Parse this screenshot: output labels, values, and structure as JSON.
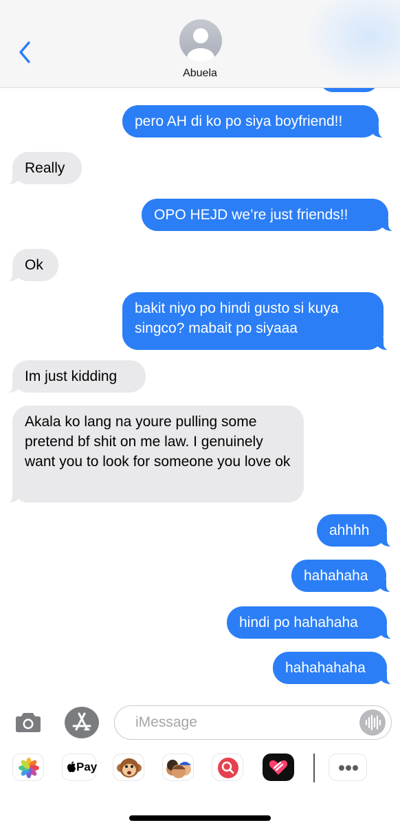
{
  "header": {
    "contact_name": "Abuela",
    "back_icon": "chevron-left-icon",
    "accent_color": "#2b7ef6"
  },
  "messages": [
    {
      "direction": "sent",
      "text": "pero AH di ko po siya boyfriend!!"
    },
    {
      "direction": "received",
      "text": "Really"
    },
    {
      "direction": "sent",
      "text": "OPO HEJD we’re just friends!!"
    },
    {
      "direction": "received",
      "text": "Ok"
    },
    {
      "direction": "sent",
      "text": "bakit niyo po hindi gusto si kuya singco? mabait po siyaaa"
    },
    {
      "direction": "received",
      "text": "Im just kidding"
    },
    {
      "direction": "received",
      "text": "Akala ko lang na youre pulling some pretend bf shit on me law. I genuinely want you to look for someone you love ok"
    },
    {
      "direction": "sent",
      "text": "ahhhh"
    },
    {
      "direction": "sent",
      "text": "hahahaha"
    },
    {
      "direction": "sent",
      "text": "hindi po hahahaha"
    },
    {
      "direction": "sent",
      "text": "hahahahaha"
    }
  ],
  "composer": {
    "placeholder": "iMessage",
    "camera_icon": "camera-icon",
    "appstore_icon": "app-store-icon",
    "dictation_icon": "waveform-icon"
  },
  "app_drawer": {
    "apps": [
      {
        "name": "photos-icon"
      },
      {
        "name": "apple-pay-icon",
        "label": "Pay"
      },
      {
        "name": "animoji-monkey-icon"
      },
      {
        "name": "memoji-icon"
      },
      {
        "name": "images-search-icon"
      },
      {
        "name": "digital-touch-icon"
      },
      {
        "name": "more-icon"
      }
    ]
  },
  "colors": {
    "sent_bubble": "#2b7ef6",
    "received_bubble": "#e9e9eb"
  }
}
